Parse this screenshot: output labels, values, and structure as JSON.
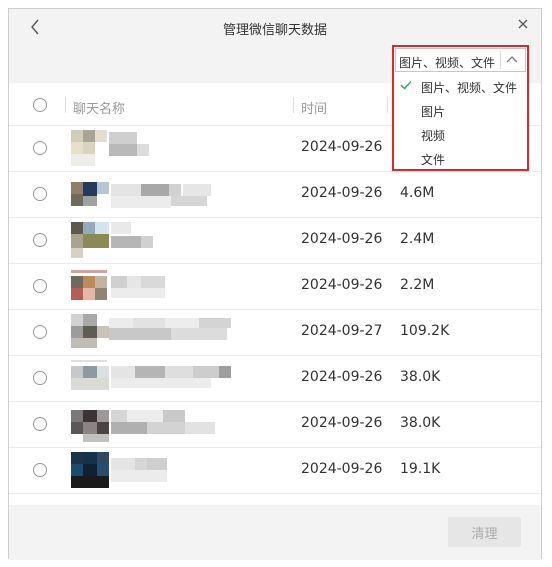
{
  "window": {
    "title": "管理微信聊天数据"
  },
  "header": {
    "name_col": "聊天名称",
    "time_col": "时间"
  },
  "filter": {
    "selected": "图片、视频、文件",
    "options": [
      "图片、视频、文件",
      "图片",
      "视频",
      "文件"
    ],
    "highlight_color": "#e0262b",
    "check_color": "#2aae67"
  },
  "rows": [
    {
      "date": "2024-09-26",
      "size": ""
    },
    {
      "date": "2024-09-26",
      "size": "4.6M"
    },
    {
      "date": "2024-09-26",
      "size": "2.4M"
    },
    {
      "date": "2024-09-26",
      "size": "2.2M"
    },
    {
      "date": "2024-09-27",
      "size": "109.2K"
    },
    {
      "date": "2024-09-26",
      "size": "38.0K"
    },
    {
      "date": "2024-09-26",
      "size": "38.0K"
    },
    {
      "date": "2024-09-26",
      "size": "19.1K"
    }
  ],
  "footer": {
    "clean_label": "清理"
  }
}
